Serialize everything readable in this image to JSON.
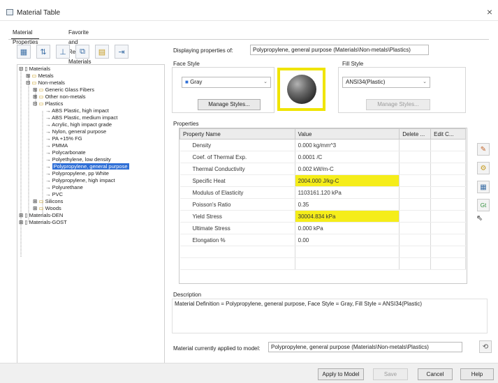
{
  "window": {
    "title": "Material Table",
    "close_glyph": "×"
  },
  "tabs": [
    {
      "label": "Material Properties"
    },
    {
      "label": "Favorite and Recent Materials"
    }
  ],
  "toolbar_icons": [
    "new-material-icon",
    "sort-icon",
    "filter-icon",
    "copy-icon",
    "folder-icon",
    "import-icon"
  ],
  "tree": {
    "items": [
      {
        "label": "Materials"
      },
      {
        "label": "Metals"
      },
      {
        "label": "Non-metals"
      },
      {
        "label": "Generic Glass Fibers"
      },
      {
        "label": "Other non-metals"
      },
      {
        "label": "Plastics"
      },
      {
        "label": "ABS Plastic, high impact"
      },
      {
        "label": "ABS Plastic, medium impact"
      },
      {
        "label": "Acrylic, high impact grade"
      },
      {
        "label": "Nylon, general purpose"
      },
      {
        "label": "PA +15% FG"
      },
      {
        "label": "PMMA"
      },
      {
        "label": "Polycarbonate"
      },
      {
        "label": "Polyethylene, low density"
      },
      {
        "label": "Polypropylene, general purpose"
      },
      {
        "label": "Polypropylene, pp White"
      },
      {
        "label": "Polypropylene, high impact"
      },
      {
        "label": "Polyurethane"
      },
      {
        "label": "PVC"
      },
      {
        "label": "Silicons"
      },
      {
        "label": "Woods"
      },
      {
        "label": "Materials-DEN"
      },
      {
        "label": "Materials-GOST"
      }
    ]
  },
  "display": {
    "label": "Displaying properties of:",
    "value": "Polypropylene, general purpose (Materials\\Non-metals\\Plastics)"
  },
  "face_style": {
    "label": "Face Style",
    "value": "Gray",
    "manage_label": "Manage Styles..."
  },
  "fill_style": {
    "label": "Fill Style",
    "value": "ANSI34(Plastic)",
    "manage_label": "Manage Styles..."
  },
  "properties": {
    "label": "Properties",
    "headers": [
      "Property Name",
      "Value",
      "Delete ...",
      "Edit C..."
    ],
    "rows": [
      {
        "name": "Density",
        "value": "0.000 kg/mm^3"
      },
      {
        "name": "Coef. of Thermal Exp.",
        "value": "0.0001 /C"
      },
      {
        "name": "Thermal Conductivity",
        "value": "0.002 kW/m-C"
      },
      {
        "name": "Specific Heat",
        "value": "2004.000 J/kg-C"
      },
      {
        "name": "Modulus of Elasticity",
        "value": "1103161.120 kPa"
      },
      {
        "name": "Poisson's Ratio",
        "value": "0.35"
      },
      {
        "name": "Yield Stress",
        "value": "30004.834 kPa"
      },
      {
        "name": "Ultimate Stress",
        "value": "0.000 kPa"
      },
      {
        "name": "Elongation %",
        "value": "0.00"
      }
    ],
    "side_icons": [
      "add-property-icon",
      "edit-property-icon",
      "table-icon",
      "units-icon"
    ]
  },
  "description": {
    "label": "Description",
    "text": "Material Definition = Polypropylene, general purpose, Face Style = Gray, Fill Style = ANSI34(Plastic)"
  },
  "applied": {
    "label": "Material currently applied to model:",
    "value": "Polypropylene, general purpose (Materials\\Non-metals\\Plastics)"
  },
  "buttons": {
    "apply": "Apply to Model",
    "save": "Save",
    "cancel": "Cancel",
    "help": "Help"
  },
  "colors": {
    "highlight": "#f5ed1a",
    "selection": "#2f6fd6"
  }
}
